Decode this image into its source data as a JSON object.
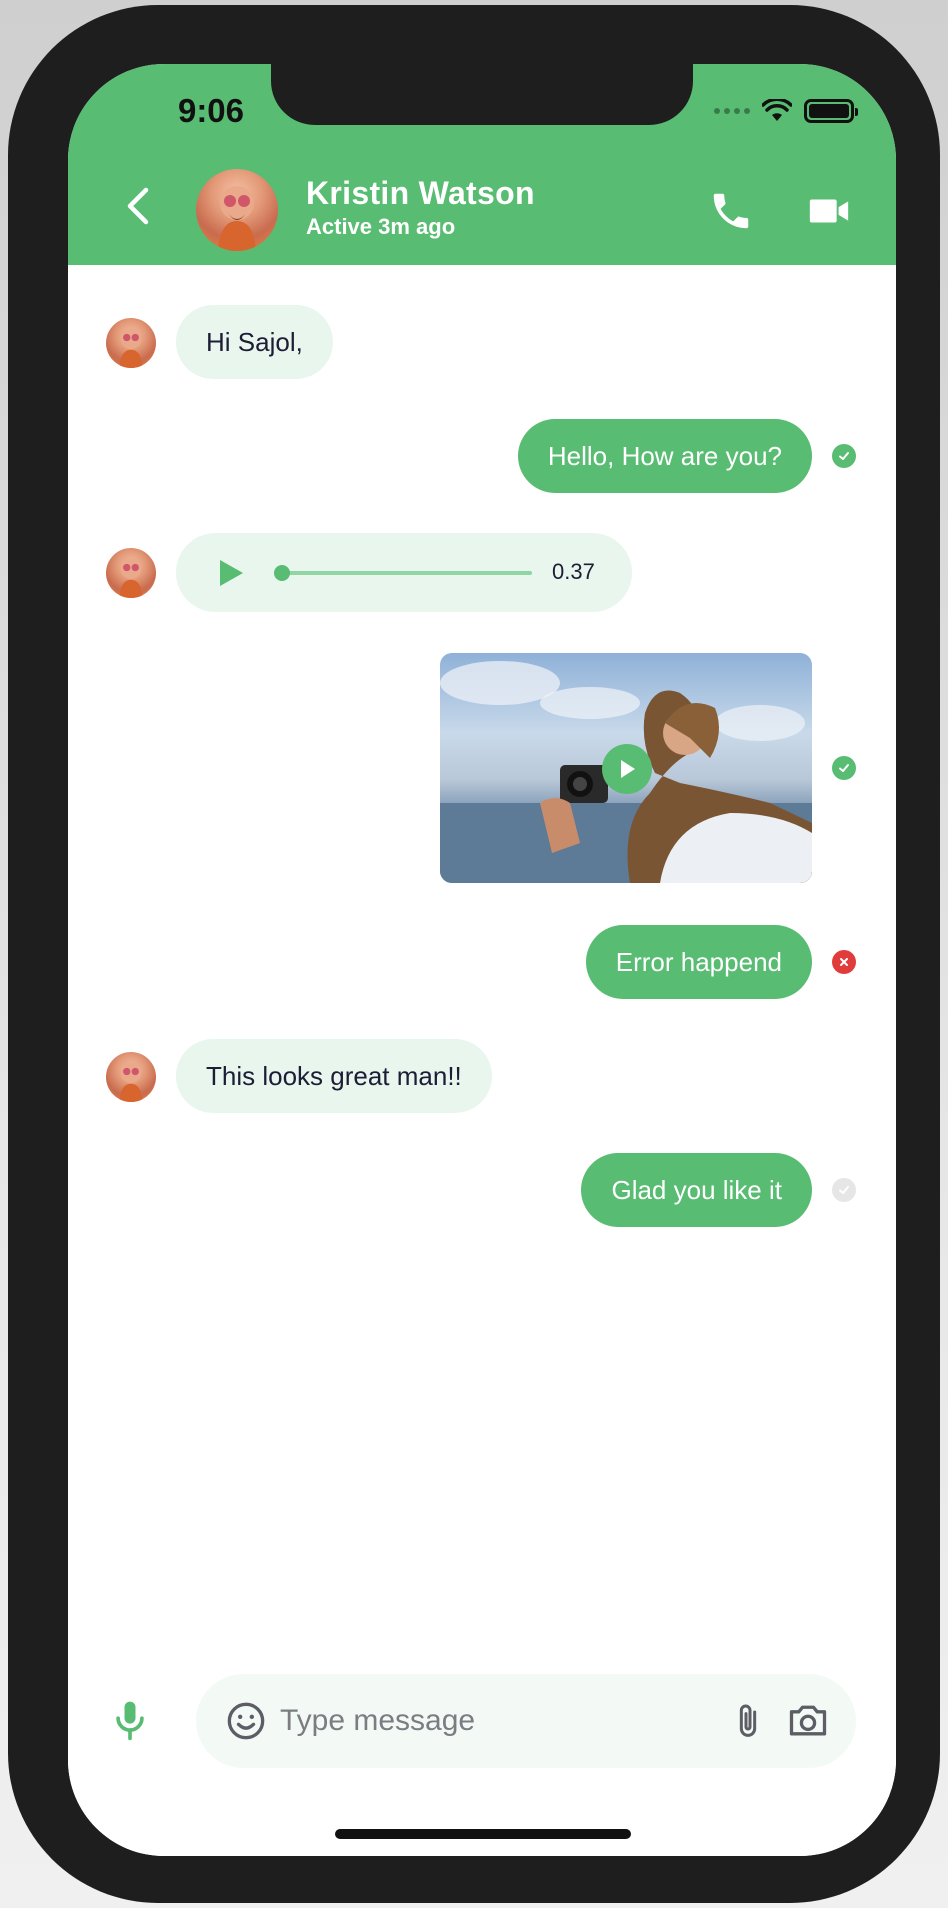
{
  "status_bar": {
    "time": "9:06"
  },
  "header": {
    "contact_name": "Kristin Watson",
    "contact_status": "Active 3m ago"
  },
  "messages": [
    {
      "type": "text",
      "direction": "incoming",
      "text": "Hi Sajol,"
    },
    {
      "type": "text",
      "direction": "outgoing",
      "text": "Hello, How are you?",
      "status": "read"
    },
    {
      "type": "audio",
      "direction": "incoming",
      "duration": "0.37",
      "progress": 0.0
    },
    {
      "type": "video",
      "direction": "outgoing",
      "status": "read"
    },
    {
      "type": "text",
      "direction": "outgoing",
      "text": "Error happend",
      "status": "error"
    },
    {
      "type": "text",
      "direction": "incoming",
      "text": "This looks great man!!"
    },
    {
      "type": "text",
      "direction": "outgoing",
      "text": "Glad you like it",
      "status": "pending"
    }
  ],
  "composer": {
    "placeholder": "Type message",
    "value": ""
  },
  "colors": {
    "primary": "#58bc72",
    "incoming_bubble": "#e8f6ed",
    "error": "#e13c3c",
    "text_dark": "#1d1d35"
  },
  "icons": [
    "back-arrow-icon",
    "phone-icon",
    "video-camera-icon",
    "play-icon",
    "check-icon",
    "close-icon",
    "microphone-icon",
    "smiley-icon",
    "paperclip-icon",
    "camera-icon"
  ]
}
